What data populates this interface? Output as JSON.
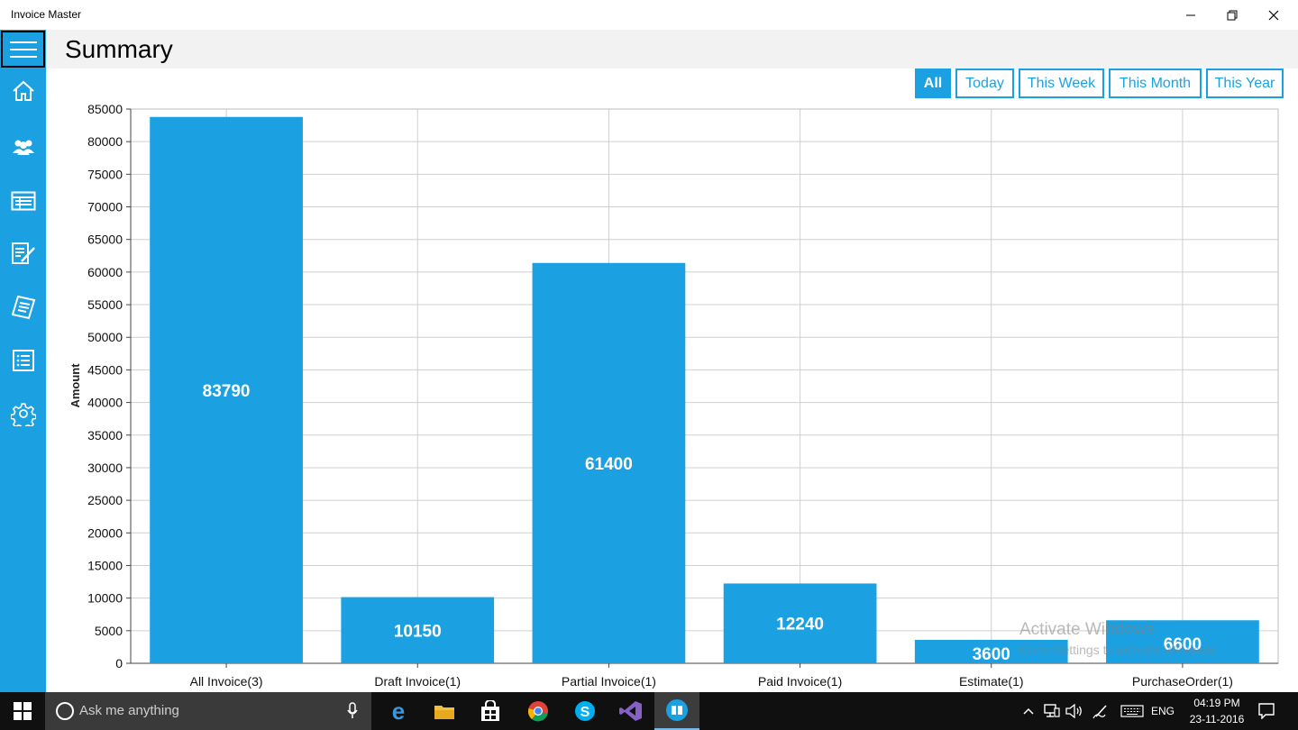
{
  "window": {
    "title": "Invoice Master"
  },
  "header": {
    "title": "Summary"
  },
  "filters": [
    {
      "label": "All",
      "active": true
    },
    {
      "label": "Today",
      "active": false
    },
    {
      "label": "This Week",
      "active": false
    },
    {
      "label": "This Month",
      "active": false
    },
    {
      "label": "This Year",
      "active": false
    }
  ],
  "sidebar": {
    "items": [
      {
        "icon": "home-icon"
      },
      {
        "icon": "customers-icon"
      },
      {
        "icon": "invoices-icon"
      },
      {
        "icon": "estimates-icon"
      },
      {
        "icon": "receipts-icon"
      },
      {
        "icon": "list-icon"
      },
      {
        "icon": "settings-icon"
      }
    ]
  },
  "chart_data": {
    "type": "bar",
    "categories": [
      "All Invoice(3)",
      "Draft Invoice(1)",
      "Partial Invoice(1)",
      "Paid Invoice(1)",
      "Estimate(1)",
      "PurchaseOrder(1)"
    ],
    "values": [
      83790,
      10150,
      61400,
      12240,
      3600,
      6600
    ],
    "ylabel": "Amount",
    "xlabel": "",
    "ylim": [
      0,
      85000
    ],
    "yticks": [
      0,
      5000,
      10000,
      15000,
      20000,
      25000,
      30000,
      35000,
      40000,
      45000,
      50000,
      55000,
      60000,
      65000,
      70000,
      75000,
      80000,
      85000
    ],
    "grid": true,
    "bar_color": "#1ba1e2",
    "data_labels": true
  },
  "watermark": {
    "line1": "Activate Windows",
    "line2": "Go to Settings to activate Windows."
  },
  "taskbar": {
    "search_placeholder": "Ask me anything",
    "apps": [
      "edge-icon",
      "file-explorer-icon",
      "store-icon",
      "chrome-icon",
      "skype-icon",
      "visual-studio-icon",
      "invoice-master-icon"
    ],
    "language": "ENG",
    "time": "04:19 PM",
    "date": "23-11-2016"
  },
  "colors": {
    "accent": "#1ba1e2",
    "taskbar": "#101010"
  }
}
